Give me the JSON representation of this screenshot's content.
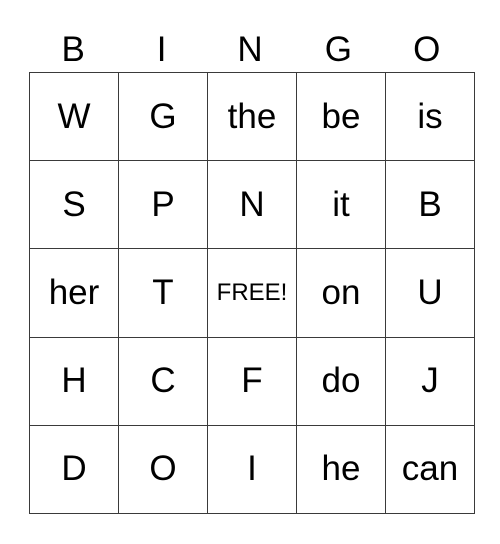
{
  "card": {
    "header": [
      "B",
      "I",
      "N",
      "G",
      "O"
    ],
    "rows": [
      [
        "W",
        "G",
        "the",
        "be",
        "is"
      ],
      [
        "S",
        "P",
        "N",
        "it",
        "B"
      ],
      [
        "her",
        "T",
        "FREE!",
        "on",
        "U"
      ],
      [
        "H",
        "C",
        "F",
        "do",
        "J"
      ],
      [
        "D",
        "O",
        "I",
        "he",
        "can"
      ]
    ],
    "free_cell": {
      "row": 2,
      "col": 2
    }
  }
}
